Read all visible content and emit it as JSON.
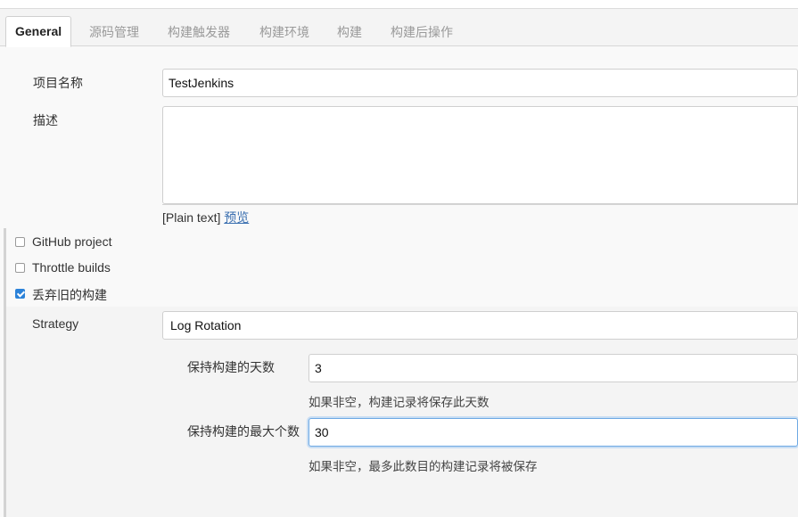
{
  "tabs": [
    {
      "label": "General"
    },
    {
      "label": "源码管理"
    },
    {
      "label": "构建触发器"
    },
    {
      "label": "构建环境"
    },
    {
      "label": "构建"
    },
    {
      "label": "构建后操作"
    }
  ],
  "general": {
    "project_name_label": "项目名称",
    "project_name_value": "TestJenkins",
    "description_label": "描述",
    "description_value": "",
    "format_prefix": "[Plain text]",
    "preview_link": "预览"
  },
  "options": [
    {
      "label": "GitHub project",
      "checked": false
    },
    {
      "label": "Throttle builds",
      "checked": false
    },
    {
      "label": "丢弃旧的构建",
      "checked": true
    }
  ],
  "discard": {
    "strategy_label": "Strategy",
    "strategy_value": "Log Rotation",
    "days_label": "保持构建的天数",
    "days_value": "3",
    "days_help": "如果非空，构建记录将保存此天数",
    "max_label": "保持构建的最大个数",
    "max_value": "30",
    "max_help": "如果非空，最多此数目的构建记录将被保存"
  },
  "colors": {
    "accent": "#2b82d9",
    "focus_ring": "#6ea9e4",
    "link": "#3a6fb0"
  }
}
